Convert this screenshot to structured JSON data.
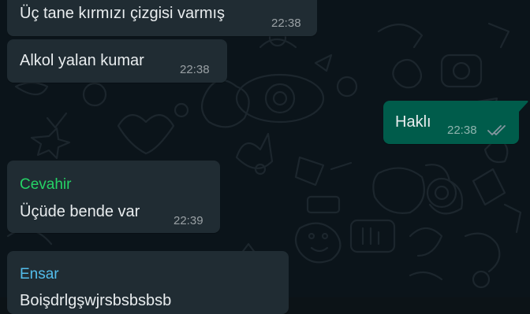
{
  "messages": [
    {
      "direction": "in",
      "text": "Üç tane kırmızı çizgisi varmış",
      "time": "22:38"
    },
    {
      "direction": "in",
      "text": "Alkol yalan kumar",
      "time": "22:38"
    },
    {
      "direction": "out",
      "text": "Haklı",
      "time": "22:38",
      "status_icon": "double-check-icon"
    },
    {
      "direction": "in",
      "sender": "Cevahir",
      "sender_color": "#25d366",
      "text": "Üçüde bende var",
      "time": "22:39"
    },
    {
      "direction": "in",
      "sender": "Ensar",
      "sender_color": "#53bdeb",
      "text": "Boişdrlgşwjrsbsbsbsb",
      "time": ""
    }
  ],
  "colors": {
    "background": "#0b141a",
    "incoming_bubble": "#202c33",
    "outgoing_bubble": "#005c4b",
    "text": "#e9edef",
    "read_ticks": "#8696a0"
  }
}
